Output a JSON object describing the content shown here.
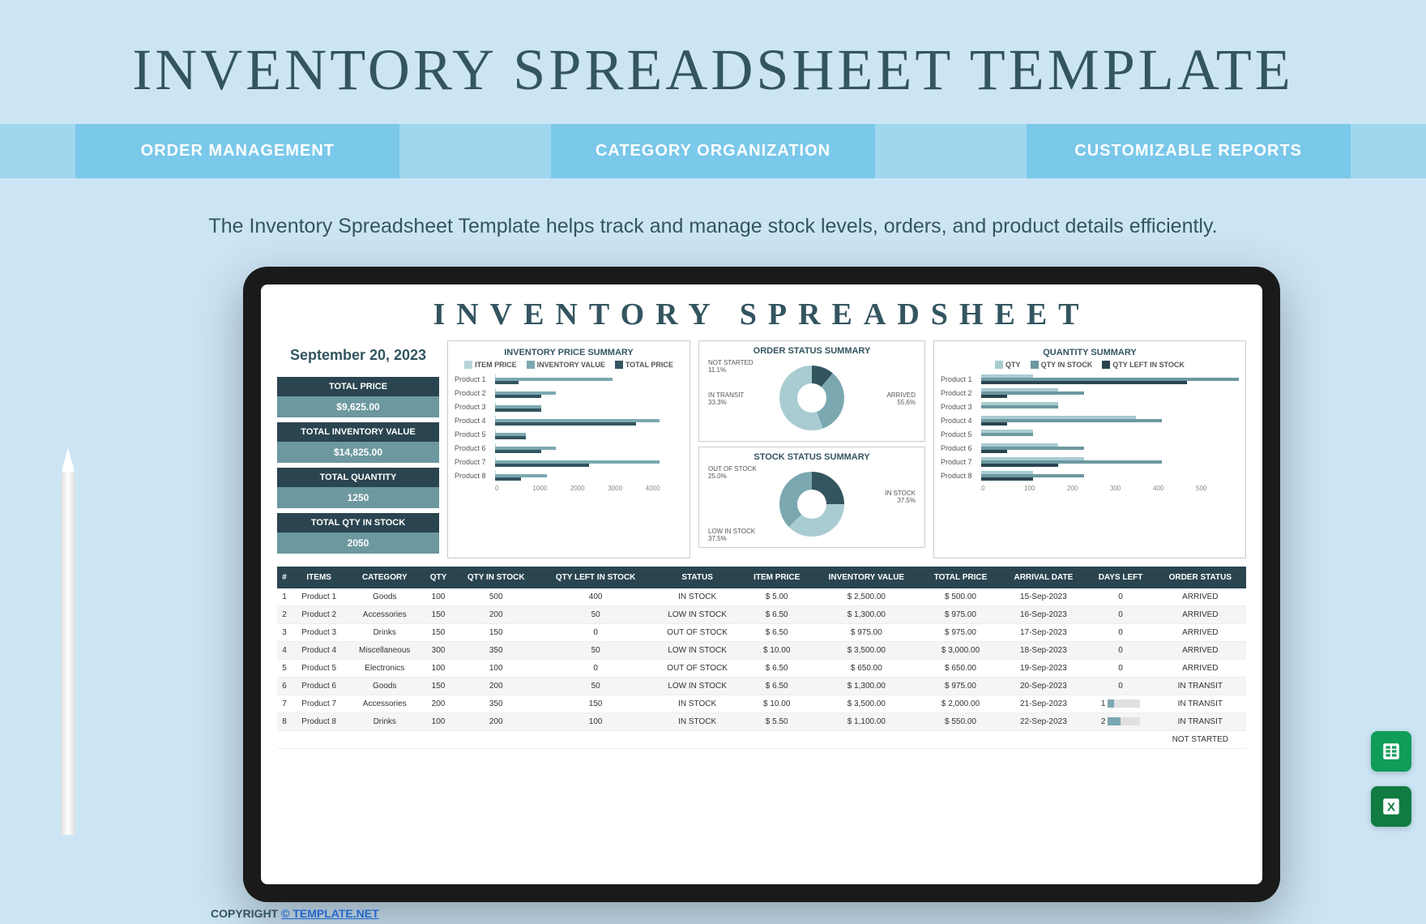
{
  "title": "INVENTORY SPREADSHEET TEMPLATE",
  "features": [
    "ORDER MANAGEMENT",
    "CATEGORY ORGANIZATION",
    "CUSTOMIZABLE REPORTS"
  ],
  "description": "The Inventory Spreadsheet Template helps track and manage stock levels, orders, and product details efficiently.",
  "sheet_title": "INVENTORY SPREADSHEET",
  "date": "September 20, 2023",
  "stats": [
    {
      "label": "TOTAL PRICE",
      "value": "$9,625.00"
    },
    {
      "label": "TOTAL INVENTORY VALUE",
      "value": "$14,825.00"
    },
    {
      "label": "TOTAL QUANTITY",
      "value": "1250"
    },
    {
      "label": "TOTAL QTY IN STOCK",
      "value": "2050"
    }
  ],
  "price_chart": {
    "title": "INVENTORY PRICE SUMMARY",
    "legend": [
      "ITEM PRICE",
      "INVENTORY VALUE",
      "TOTAL PRICE"
    ],
    "products": [
      "Product 1",
      "Product 2",
      "Product 3",
      "Product 4",
      "Product 5",
      "Product 6",
      "Product 7",
      "Product 8"
    ],
    "axis": [
      "0",
      "1000",
      "2000",
      "3000",
      "4000"
    ]
  },
  "order_donut": {
    "title": "ORDER STATUS SUMMARY",
    "labels": [
      {
        "t": "NOT STARTED",
        "v": "11.1%"
      },
      {
        "t": "IN TRANSIT",
        "v": "33.3%"
      },
      {
        "t": "ARRIVED",
        "v": "55.6%"
      }
    ]
  },
  "stock_donut": {
    "title": "STOCK STATUS SUMMARY",
    "labels": [
      {
        "t": "OUT OF STOCK",
        "v": "25.0%"
      },
      {
        "t": "LOW IN STOCK",
        "v": "37.5%"
      },
      {
        "t": "IN STOCK",
        "v": "37.5%"
      }
    ]
  },
  "qty_chart": {
    "title": "QUANTITY SUMMARY",
    "legend": [
      "QTY",
      "QTY IN STOCK",
      "QTY LEFT IN STOCK"
    ],
    "products": [
      "Product 1",
      "Product 2",
      "Product 3",
      "Product 4",
      "Product 5",
      "Product 6",
      "Product 7",
      "Product 8"
    ],
    "axis": [
      "0",
      "100",
      "200",
      "300",
      "400",
      "500"
    ]
  },
  "table": {
    "headers": [
      "#",
      "ITEMS",
      "CATEGORY",
      "QTY",
      "QTY IN STOCK",
      "QTY LEFT IN STOCK",
      "STATUS",
      "ITEM PRICE",
      "INVENTORY VALUE",
      "TOTAL PRICE",
      "ARRIVAL DATE",
      "DAYS LEFT",
      "ORDER STATUS"
    ],
    "rows": [
      [
        "1",
        "Product 1",
        "Goods",
        "100",
        "500",
        "400",
        "IN STOCK",
        "$        5.00",
        "$    2,500.00",
        "$     500.00",
        "15-Sep-2023",
        "0",
        "ARRIVED"
      ],
      [
        "2",
        "Product 2",
        "Accessories",
        "150",
        "200",
        "50",
        "LOW IN STOCK",
        "$        6.50",
        "$    1,300.00",
        "$     975.00",
        "16-Sep-2023",
        "0",
        "ARRIVED"
      ],
      [
        "3",
        "Product 3",
        "Drinks",
        "150",
        "150",
        "0",
        "OUT OF STOCK",
        "$        6.50",
        "$       975.00",
        "$     975.00",
        "17-Sep-2023",
        "0",
        "ARRIVED"
      ],
      [
        "4",
        "Product 4",
        "Miscellaneous",
        "300",
        "350",
        "50",
        "LOW IN STOCK",
        "$      10.00",
        "$    3,500.00",
        "$  3,000.00",
        "18-Sep-2023",
        "0",
        "ARRIVED"
      ],
      [
        "5",
        "Product 5",
        "Electronics",
        "100",
        "100",
        "0",
        "OUT OF STOCK",
        "$        6.50",
        "$       650.00",
        "$     650.00",
        "19-Sep-2023",
        "0",
        "ARRIVED"
      ],
      [
        "6",
        "Product 6",
        "Goods",
        "150",
        "200",
        "50",
        "LOW IN STOCK",
        "$        6.50",
        "$    1,300.00",
        "$     975.00",
        "20-Sep-2023",
        "0",
        "IN TRANSIT"
      ],
      [
        "7",
        "Product 7",
        "Accessories",
        "200",
        "350",
        "150",
        "IN STOCK",
        "$      10.00",
        "$    3,500.00",
        "$  2,000.00",
        "21-Sep-2023",
        "1",
        "IN TRANSIT"
      ],
      [
        "8",
        "Product 8",
        "Drinks",
        "100",
        "200",
        "100",
        "IN STOCK",
        "$        5.50",
        "$    1,100.00",
        "$     550.00",
        "22-Sep-2023",
        "2",
        "IN TRANSIT"
      ],
      [
        "",
        "",
        "",
        "",
        "",
        "",
        "",
        "",
        "",
        "",
        "",
        "",
        "NOT STARTED"
      ]
    ]
  },
  "copyright": {
    "prefix": "COPYRIGHT ",
    "link": "© TEMPLATE.NET"
  },
  "chart_data": [
    {
      "type": "bar",
      "title": "INVENTORY PRICE SUMMARY",
      "categories": [
        "Product 1",
        "Product 2",
        "Product 3",
        "Product 4",
        "Product 5",
        "Product 6",
        "Product 7",
        "Product 8"
      ],
      "series": [
        {
          "name": "ITEM PRICE",
          "values": [
            5,
            6.5,
            6.5,
            10,
            6.5,
            6.5,
            10,
            5.5
          ]
        },
        {
          "name": "INVENTORY VALUE",
          "values": [
            2500,
            1300,
            975,
            3500,
            650,
            1300,
            3500,
            1100
          ]
        },
        {
          "name": "TOTAL PRICE",
          "values": [
            500,
            975,
            975,
            3000,
            650,
            975,
            2000,
            550
          ]
        }
      ],
      "xlim": [
        0,
        4000
      ]
    },
    {
      "type": "pie",
      "title": "ORDER STATUS SUMMARY",
      "categories": [
        "NOT STARTED",
        "IN TRANSIT",
        "ARRIVED"
      ],
      "values": [
        11.1,
        33.3,
        55.6
      ]
    },
    {
      "type": "pie",
      "title": "STOCK STATUS SUMMARY",
      "categories": [
        "OUT OF STOCK",
        "LOW IN STOCK",
        "IN STOCK"
      ],
      "values": [
        25.0,
        37.5,
        37.5
      ]
    },
    {
      "type": "bar",
      "title": "QUANTITY SUMMARY",
      "categories": [
        "Product 1",
        "Product 2",
        "Product 3",
        "Product 4",
        "Product 5",
        "Product 6",
        "Product 7",
        "Product 8"
      ],
      "series": [
        {
          "name": "QTY",
          "values": [
            100,
            150,
            150,
            300,
            100,
            150,
            200,
            100
          ]
        },
        {
          "name": "QTY IN STOCK",
          "values": [
            500,
            200,
            150,
            350,
            100,
            200,
            350,
            200
          ]
        },
        {
          "name": "QTY LEFT IN STOCK",
          "values": [
            400,
            50,
            0,
            50,
            0,
            50,
            150,
            100
          ]
        }
      ],
      "xlim": [
        0,
        500
      ]
    }
  ]
}
